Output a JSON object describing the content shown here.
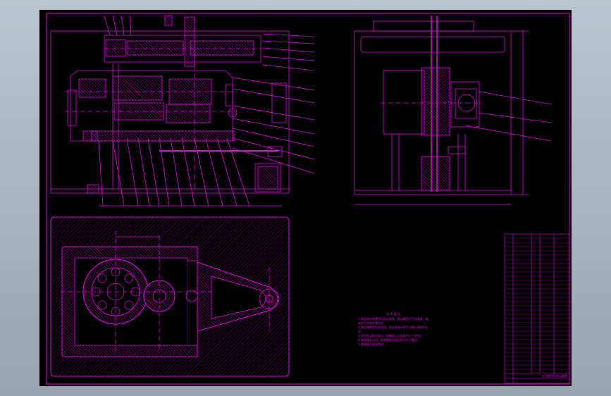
{
  "viewer": {
    "background_top": "#bcc5cf",
    "background_bottom": "#9aa4ae"
  },
  "drawing": {
    "sheet_color": "#000000",
    "line_color": "#e000e0",
    "accent_color": "#ff00ff",
    "dim_color": "#b000b0",
    "notes_title": "技 术 要 求",
    "notes_lines": [
      "1.装配前所有零件用煤油清洗，滚动轴承用汽油清洗，箱体内不许有杂物存在。",
      "2.啮合侧隙用铅丝检验，铅丝直径不得大于最小侧隙的4倍。",
      "3.用涂色法检验斑点，接触斑点沿齿高不小于40%。",
      "4.减速器剖分面、各接触面及密封处均不许漏油。",
      "5.减速器内装润滑油。"
    ],
    "title_block_name": "立式搅拌机传动装置"
  }
}
